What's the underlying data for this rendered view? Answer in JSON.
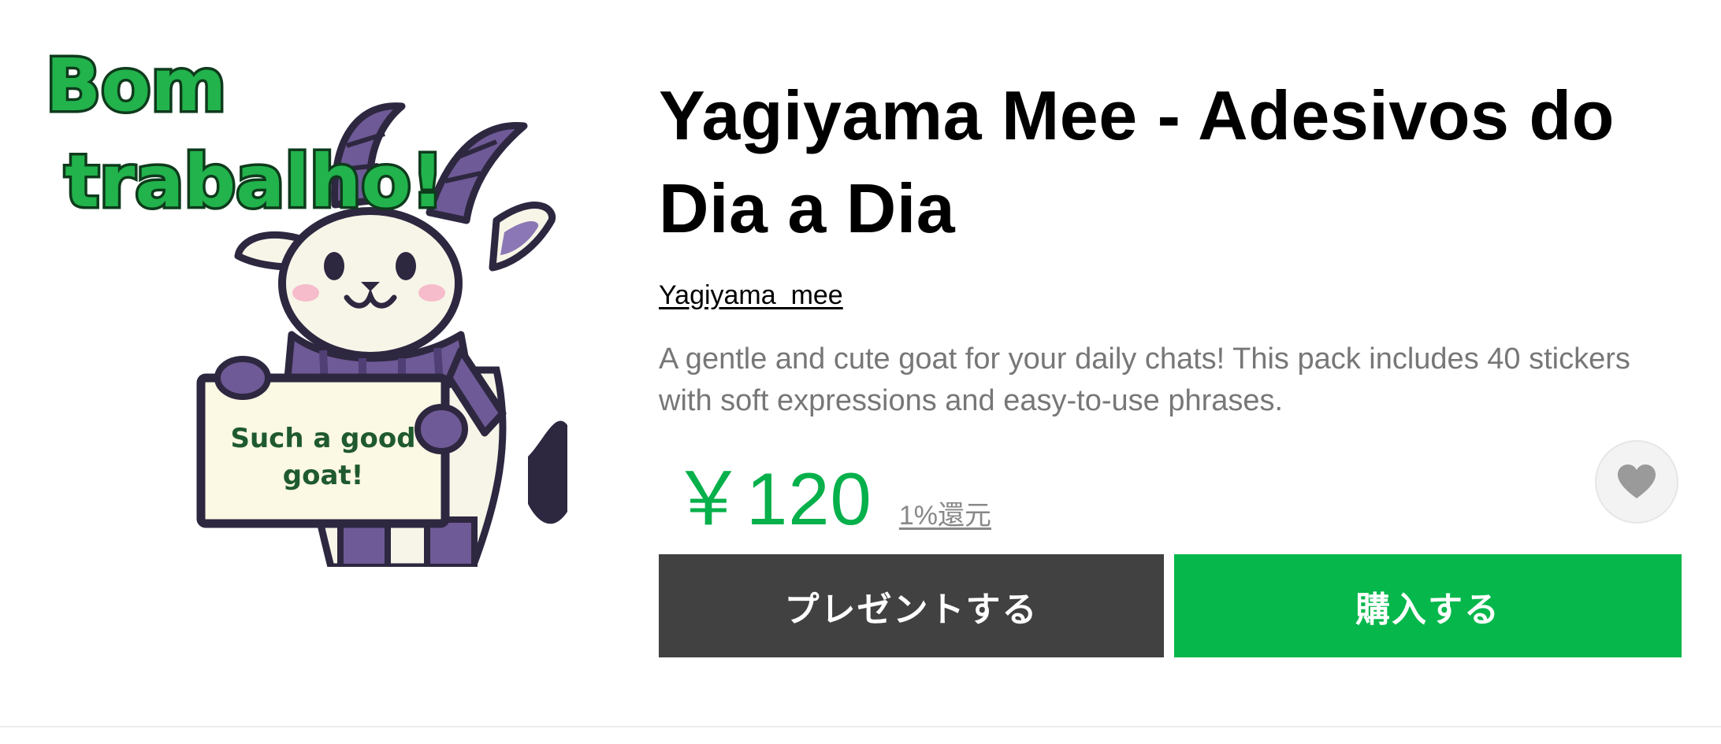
{
  "product": {
    "title": "Yagiyama Mee - Adesivos do Dia a Dia",
    "author": "Yagiyama_mee",
    "description": "A gentle and cute goat for your daily chats! This pack includes 40 stickers with soft expressions and easy-to-use phrases.",
    "price": "￥120",
    "reward": "1%還元"
  },
  "sticker": {
    "caption_line1": "Bom",
    "caption_line2": "trabalho!",
    "sign_line1": "Such a good",
    "sign_line2": "goat!"
  },
  "actions": {
    "gift_label": "プレゼントする",
    "buy_label": "購入する"
  },
  "icons": {
    "favorite": "heart-icon"
  },
  "colors": {
    "price": "#06b04a",
    "buy_button": "#06b74b",
    "gift_button": "#414141",
    "caption_fill": "#22b34c",
    "goat_horn": "#6e5a96",
    "sign_text": "#1f5a2e"
  }
}
